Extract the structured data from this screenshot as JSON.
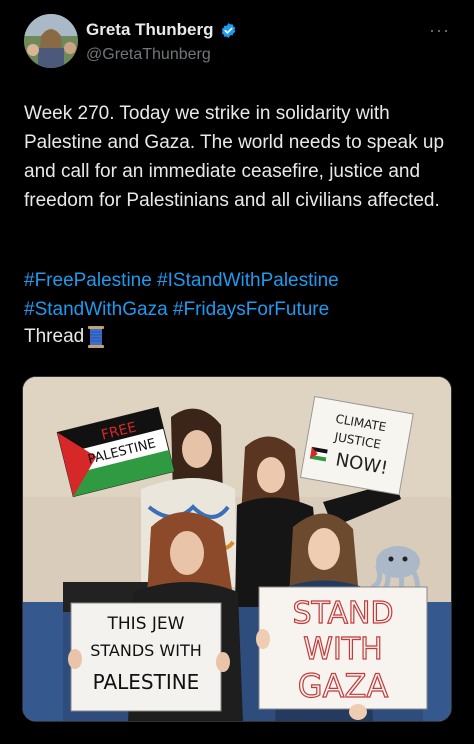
{
  "author": {
    "display_name": "Greta Thunberg",
    "handle": "@GretaThunberg",
    "verified_icon": "verified-badge-icon",
    "verified_color": "#1d9bf0"
  },
  "more_menu": "···",
  "tweet": {
    "text": "Week 270. Today we strike in solidarity with Palestine and Gaza. The world needs to speak up and call for an immediate ceasefire, justice and freedom for Palestinians and all civilians affected.",
    "hashtags": [
      "#FreePalestine",
      "#IStandWithPalestine",
      "#StandWithGaza",
      "#FridaysForFuture"
    ],
    "thread_label": "Thread",
    "thread_icon": "spool-of-thread-icon"
  },
  "photo_signs": {
    "free_palestine": [
      "FREE",
      "PALESTINE"
    ],
    "climate_justice": [
      "CLIMATE",
      "JUSTICE",
      "NOW!"
    ],
    "this_jew": [
      "THIS JEW",
      "STANDS WITH",
      "PALESTINE"
    ],
    "stand_with_gaza": [
      "STAND",
      "WITH",
      "GAZA"
    ]
  },
  "colors": {
    "background": "#000000",
    "text": "#e7e9ea",
    "secondary": "#71767b",
    "link": "#1d9bf0"
  }
}
